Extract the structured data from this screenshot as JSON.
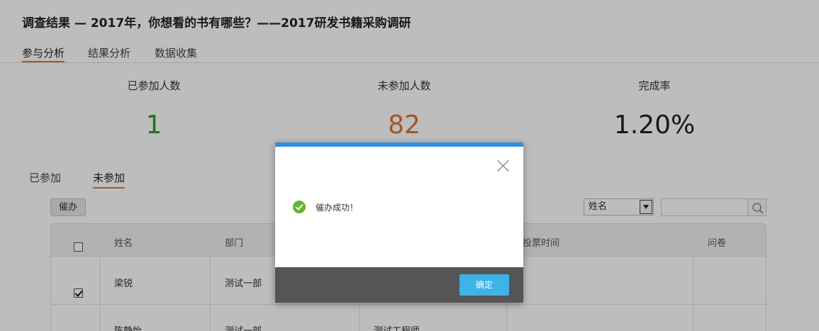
{
  "title": "调查结果 — 2017年，你想看的书有哪些？——2017研发书籍采购调研",
  "tabs": [
    {
      "label": "参与分析",
      "active": true
    },
    {
      "label": "结果分析",
      "active": false
    },
    {
      "label": "数据收集",
      "active": false
    }
  ],
  "stats": {
    "participated": {
      "label": "已参加人数",
      "value": "1",
      "color": "#2e9a2e"
    },
    "not_participated": {
      "label": "未参加人数",
      "value": "82",
      "color": "#d9762e"
    },
    "completion": {
      "label": "完成率",
      "value": "1.20%",
      "color": "#222222"
    }
  },
  "subtabs": [
    {
      "label": "已参加",
      "active": false
    },
    {
      "label": "未参加",
      "active": true
    }
  ],
  "urge_button": "催办",
  "search": {
    "field_selected": "姓名",
    "value": ""
  },
  "table": {
    "headers": [
      "姓名",
      "部门",
      "投票时间",
      "问卷"
    ],
    "rows": [
      {
        "checked": true,
        "name": "梁锐",
        "dept": "测试一部",
        "position": ""
      },
      {
        "checked": false,
        "name": "陈静怡",
        "dept": "测试一部",
        "position": "测试工程师"
      }
    ]
  },
  "dialog": {
    "message": "催办成功！",
    "ok_label": "确定",
    "accent": "#2d8fe0",
    "ok_color": "#3db3e8",
    "success_color": "#62b72c"
  }
}
